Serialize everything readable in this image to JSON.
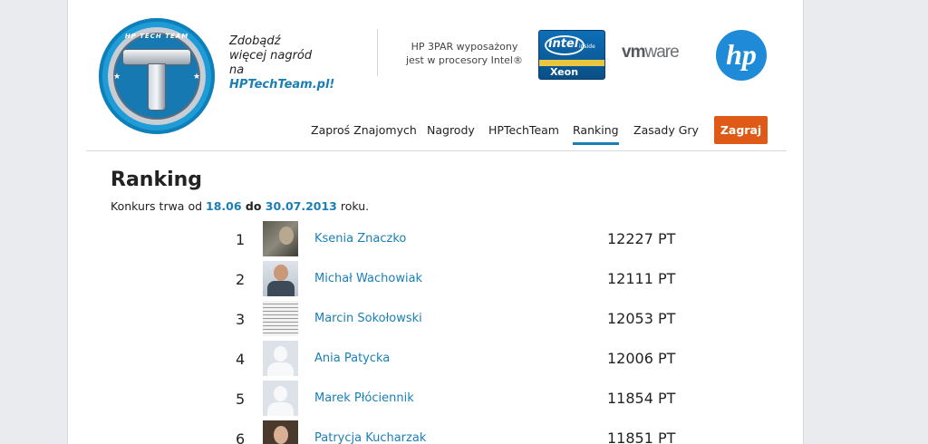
{
  "header": {
    "logo_text": "HP TECH TEAM",
    "promo_line1": "Zdobądź",
    "promo_line2": "więcej nagród",
    "promo_line3_prefix": "na ",
    "promo_link": "HPTechTeam.pl!",
    "intel_line1": "HP 3PAR wyposażony",
    "intel_line2": "jest w procesory Intel®",
    "intel_badge_brand": "intel",
    "intel_badge_inside": "inside",
    "intel_badge_product": "Xeon",
    "vmware_text": "vm",
    "vmware_text2": "ware",
    "hp_logo_text": "hp"
  },
  "nav": {
    "items": [
      {
        "label": "Zaproś Znajomych"
      },
      {
        "label": "Nagrody"
      },
      {
        "label": "HPTechTeam"
      },
      {
        "label": "Ranking",
        "active": true
      },
      {
        "label": "Zasady Gry"
      }
    ],
    "play_button": "Zagraj"
  },
  "main": {
    "title": "Ranking",
    "contest_prefix": "Konkurs trwa od ",
    "date_from": "18.06",
    "date_sep": " do ",
    "date_to": "30.07.2013",
    "contest_suffix": " roku."
  },
  "ranking": [
    {
      "rank": "1",
      "name": "Ksenia Znaczko",
      "points": "12227 PT",
      "avatar": "photo-dark"
    },
    {
      "rank": "2",
      "name": "Michał Wachowiak",
      "points": "12111 PT",
      "avatar": "photo-man"
    },
    {
      "rank": "3",
      "name": "Marcin Sokołowski",
      "points": "12053 PT",
      "avatar": "photo-document"
    },
    {
      "rank": "4",
      "name": "Ania Patycka",
      "points": "12006 PT",
      "avatar": "default-silhouette"
    },
    {
      "rank": "5",
      "name": "Marek Płóciennik",
      "points": "11854 PT",
      "avatar": "default-silhouette"
    },
    {
      "rank": "6",
      "name": "Patrycja Kucharzak",
      "points": "11851 PT",
      "avatar": "photo-woman"
    }
  ],
  "colors": {
    "accent": "#1a7fb6",
    "play_button": "#e05a17",
    "page_bg": "#e9ebee"
  }
}
